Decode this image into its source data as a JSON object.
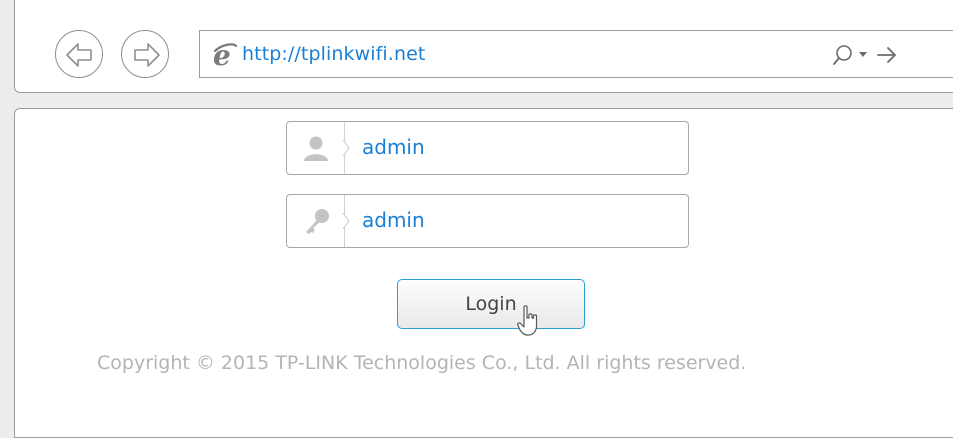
{
  "browser": {
    "back_icon": "back-arrow-icon",
    "forward_icon": "forward-arrow-icon",
    "address_bar": {
      "url": "http://tplinkwifi.net",
      "browser_icon": "ie-logo-icon",
      "search_icon": "search-icon",
      "dropdown_icon": "dropdown-icon",
      "go_icon": "go-arrow-icon"
    }
  },
  "login": {
    "username": {
      "icon": "user-icon",
      "value": "admin"
    },
    "password": {
      "icon": "key-icon",
      "value": "admin"
    },
    "button_label": "Login"
  },
  "footer": {
    "copyright": "Copyright © 2015 TP-LINK Technologies Co., Ltd. All rights reserved."
  },
  "colors": {
    "link_blue": "#1a7fd6",
    "button_border": "#2aa0d8",
    "copyright_gray": "#b4b4b4"
  }
}
